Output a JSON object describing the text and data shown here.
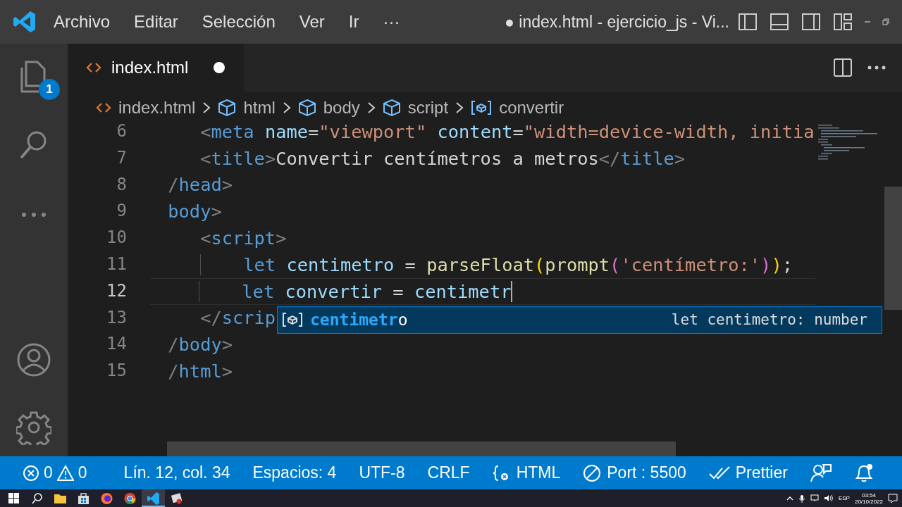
{
  "title_bar": {
    "menu": [
      "Archivo",
      "Editar",
      "Selección",
      "Ver",
      "Ir",
      "···"
    ],
    "title": "● index.html - ejercicio_js - Vi..."
  },
  "activity_bar": {
    "explorer_badge": "1"
  },
  "tabs": [
    {
      "label": "index.html",
      "selected": true,
      "modified": true
    }
  ],
  "breadcrumb": [
    {
      "kind": "file",
      "label": "index.html"
    },
    {
      "kind": "element",
      "label": "html"
    },
    {
      "kind": "element",
      "label": "body"
    },
    {
      "kind": "element",
      "label": "script"
    },
    {
      "kind": "variable",
      "label": "convertir"
    }
  ],
  "editor": {
    "lines": [
      {
        "number": "6",
        "current": false,
        "tokens": [
          {
            "kind": "bracket",
            "text": "    <"
          },
          {
            "kind": "tag",
            "text": "meta"
          },
          {
            "kind": "attr",
            "text": " name"
          },
          {
            "kind": "plain",
            "text": "="
          },
          {
            "kind": "str",
            "text": "\"viewport\""
          },
          {
            "kind": "attr",
            "text": " content"
          },
          {
            "kind": "plain",
            "text": "="
          },
          {
            "kind": "str",
            "text": "\"width=device-width, initia"
          }
        ]
      },
      {
        "number": "7",
        "current": false,
        "tokens": [
          {
            "kind": "bracket",
            "text": "    <"
          },
          {
            "kind": "tag",
            "text": "title"
          },
          {
            "kind": "bracket",
            "text": ">"
          },
          {
            "kind": "plain",
            "text": "Convertir centímetros a metros"
          },
          {
            "kind": "bracket",
            "text": "</"
          },
          {
            "kind": "tag",
            "text": "title"
          },
          {
            "kind": "bracket",
            "text": ">"
          }
        ]
      },
      {
        "number": "8",
        "current": false,
        "tokens": [
          {
            "kind": "bracket",
            "text": " /"
          },
          {
            "kind": "tag",
            "text": "head"
          },
          {
            "kind": "bracket",
            "text": ">"
          }
        ]
      },
      {
        "number": "9",
        "current": false,
        "tokens": [
          {
            "kind": "tag",
            "text": " body"
          },
          {
            "kind": "bracket",
            "text": ">"
          }
        ]
      },
      {
        "number": "10",
        "current": false,
        "tokens": [
          {
            "kind": "bracket",
            "text": "    <"
          },
          {
            "kind": "tag",
            "text": "script"
          },
          {
            "kind": "bracket",
            "text": ">"
          }
        ]
      },
      {
        "number": "11",
        "current": false,
        "tokens": [
          {
            "kind": "keyword",
            "text": "        let"
          },
          {
            "kind": "var",
            "text": " centimetro"
          },
          {
            "kind": "plain",
            "text": " = "
          },
          {
            "kind": "func",
            "text": "parseFloat"
          },
          {
            "kind": "paren1",
            "text": "("
          },
          {
            "kind": "func",
            "text": "prompt"
          },
          {
            "kind": "paren2",
            "text": "("
          },
          {
            "kind": "str",
            "text": "'centímetro:'"
          },
          {
            "kind": "paren2",
            "text": ")"
          },
          {
            "kind": "paren1",
            "text": ")"
          },
          {
            "kind": "plain",
            "text": ";"
          }
        ]
      },
      {
        "number": "12",
        "current": true,
        "tokens": [
          {
            "kind": "keyword",
            "text": "        let"
          },
          {
            "kind": "var",
            "text": " convertir"
          },
          {
            "kind": "plain",
            "text": " = "
          },
          {
            "kind": "var",
            "text": "centimetr"
          }
        ]
      },
      {
        "number": "13",
        "current": false,
        "tokens": [
          {
            "kind": "bracket",
            "text": "    </"
          },
          {
            "kind": "tag",
            "text": "scrip"
          }
        ]
      },
      {
        "number": "14",
        "current": false,
        "tokens": [
          {
            "kind": "bracket",
            "text": " /"
          },
          {
            "kind": "tag",
            "text": "body"
          },
          {
            "kind": "bracket",
            "text": ">"
          }
        ]
      },
      {
        "number": "15",
        "current": false,
        "tokens": [
          {
            "kind": "bracket",
            "text": " /"
          },
          {
            "kind": "tag",
            "text": "html"
          },
          {
            "kind": "bracket",
            "text": ">"
          }
        ]
      }
    ]
  },
  "suggest": {
    "items": [
      {
        "match": "centimetr",
        "rest": "o",
        "detail": "let centimetro: number",
        "selected": true
      }
    ]
  },
  "status_bar": {
    "errors": "0",
    "warnings": "0",
    "items": [
      {
        "kind": "text",
        "text": "Lín. 12, col. 34"
      },
      {
        "kind": "text",
        "text": "Espacios: 4"
      },
      {
        "kind": "text",
        "text": "UTF-8"
      },
      {
        "kind": "text",
        "text": "CRLF"
      },
      {
        "kind": "language",
        "text": "HTML"
      },
      {
        "kind": "port",
        "text": "Port : 5500"
      },
      {
        "kind": "prettier",
        "text": "Prettier"
      }
    ]
  },
  "taskbar": {
    "apps": [
      {
        "kind": "start",
        "selected": false
      },
      {
        "kind": "search",
        "selected": false
      },
      {
        "kind": "folder",
        "selected": false
      },
      {
        "kind": "store",
        "selected": false
      },
      {
        "kind": "firefox",
        "selected": false
      },
      {
        "kind": "chrome",
        "selected": false
      },
      {
        "kind": "vscode",
        "selected": true
      },
      {
        "kind": "app",
        "selected": false
      }
    ],
    "language": "ESP",
    "time": "03:54",
    "date": "20/10/2022"
  }
}
